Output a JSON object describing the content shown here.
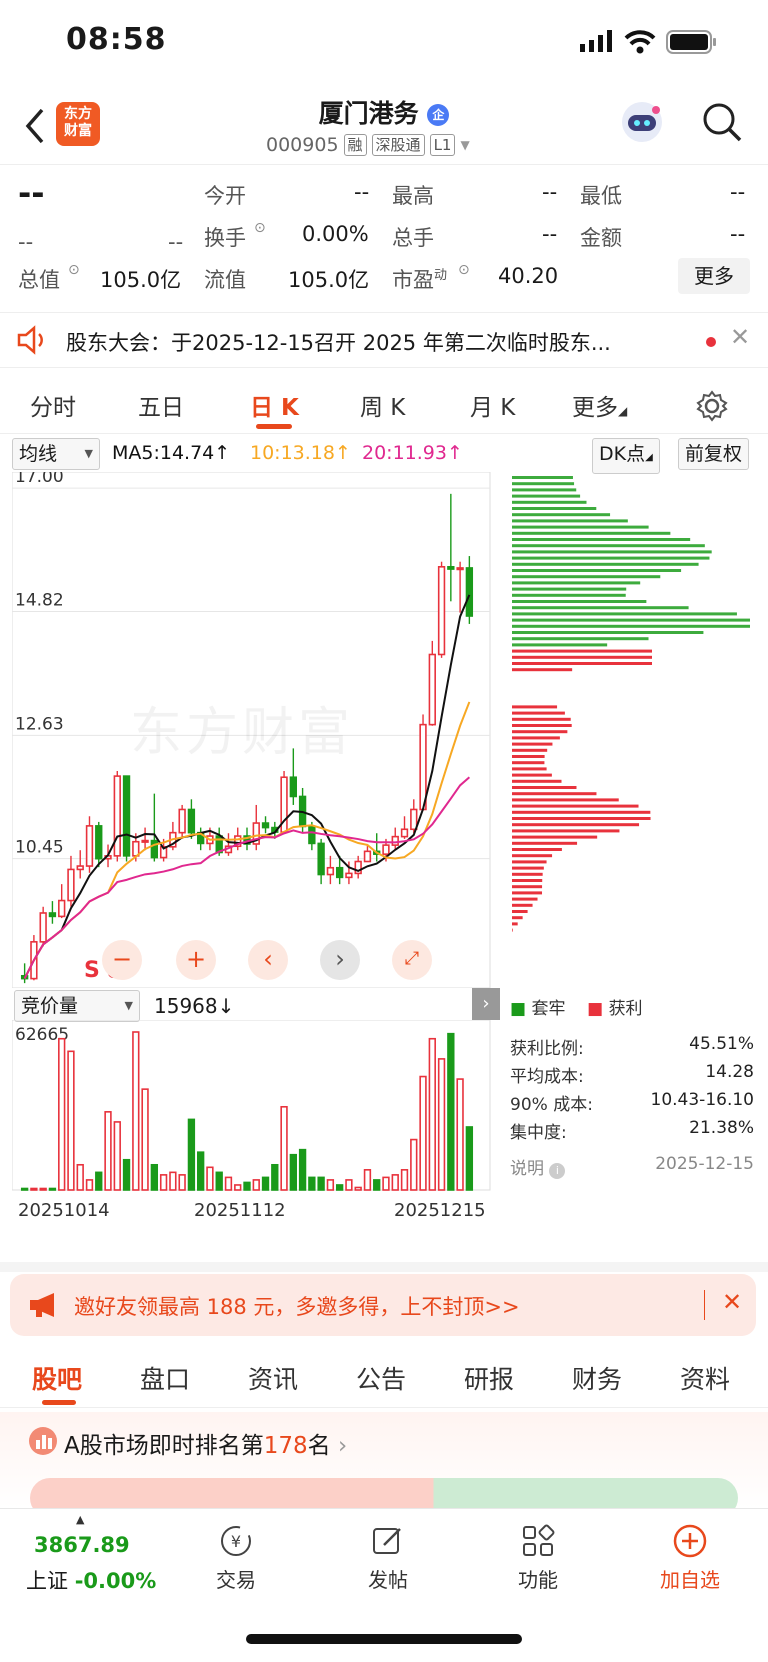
{
  "status_bar": {
    "time": "08:58"
  },
  "header": {
    "back_icon": "chevron-left-icon",
    "logo_text_1": "东方",
    "logo_text_2": "财富",
    "stock_name": "厦门港务",
    "badge": "企",
    "code": "000905",
    "tags": [
      "融",
      "深股通",
      "L1"
    ]
  },
  "quote": {
    "price": "--",
    "change": "--",
    "change_pct": "--",
    "rows": [
      [
        {
          "label": "今开",
          "value": "--"
        },
        {
          "label": "最高",
          "value": "--"
        },
        {
          "label": "最低",
          "value": "--"
        }
      ],
      [
        {
          "label": "换手",
          "value": "0.00%"
        },
        {
          "label": "总手",
          "value": "--"
        },
        {
          "label": "金额",
          "value": "--"
        }
      ],
      [
        {
          "label": "总值",
          "value": "105.0亿"
        },
        {
          "label": "流值",
          "value": "105.0亿"
        },
        {
          "label": "市盈",
          "sup": "动",
          "value": "40.20"
        }
      ]
    ],
    "more": "更多"
  },
  "notice": {
    "text": "股东大会：于2025-12-15召开 2025 年第二次临时股东..."
  },
  "chart_tabs": [
    "分时",
    "五日",
    "日 K",
    "周 K",
    "月 K",
    "更多"
  ],
  "ma_bar": {
    "selector": "均线",
    "ma5": "MA5:14.74↑",
    "ma10": "10:13.18↑",
    "ma20": "20:11.93↑",
    "dk": "DK点",
    "adjust": "前复权"
  },
  "colors": {
    "up": "#e8323c",
    "down": "#1a9a1a",
    "ma5": "#111111",
    "ma10": "#f7a823",
    "ma20": "#e0288f",
    "accent": "#e8481c"
  },
  "chart_data": [
    {
      "type": "candlestick",
      "yticks": [
        "17.00",
        "14.82",
        "12.63",
        "10.45"
      ],
      "ylim": [
        8.27,
        17.18
      ],
      "series": {
        "ma5_last": 14.74,
        "ma10_last": 13.18,
        "ma20_last": 11.93
      },
      "open": [
        8.38,
        8.33,
        8.98,
        9.49,
        9.43,
        9.71,
        10.26,
        10.32,
        11.03,
        10.45,
        10.5,
        11.91,
        10.5,
        10.75,
        10.77,
        10.47,
        10.66,
        10.91,
        11.32,
        10.91,
        10.72,
        10.85,
        10.56,
        10.67,
        10.85,
        10.71,
        11.08,
        11.0,
        10.92,
        11.89,
        11.55,
        11.02,
        10.72,
        10.17,
        10.29,
        10.12,
        10.19,
        10.4,
        10.58,
        10.53,
        10.69,
        10.84,
        10.97,
        11.32,
        12.82,
        14.06,
        15.61,
        15.57,
        15.59
      ],
      "close": [
        8.33,
        8.98,
        9.49,
        9.43,
        9.71,
        10.26,
        10.32,
        11.03,
        10.45,
        10.5,
        11.91,
        10.5,
        10.75,
        10.77,
        10.47,
        10.66,
        10.91,
        11.32,
        10.91,
        10.72,
        10.85,
        10.56,
        10.67,
        10.85,
        10.71,
        11.08,
        11.0,
        10.92,
        11.89,
        11.55,
        11.02,
        10.72,
        10.17,
        10.29,
        10.12,
        10.19,
        10.4,
        10.58,
        10.53,
        10.69,
        10.84,
        10.97,
        11.32,
        12.82,
        14.06,
        15.61,
        15.57,
        15.59,
        14.74
      ],
      "high": [
        8.6,
        9.1,
        9.6,
        9.7,
        10.0,
        10.5,
        10.6,
        11.2,
        11.1,
        10.7,
        12.0,
        11.9,
        10.9,
        11.0,
        11.6,
        10.8,
        11.1,
        11.4,
        11.5,
        11.0,
        11.0,
        11.0,
        10.9,
        11.0,
        11.0,
        11.4,
        11.2,
        11.1,
        12.0,
        12.4,
        11.7,
        11.1,
        10.8,
        10.5,
        10.5,
        10.4,
        10.5,
        10.7,
        10.9,
        10.8,
        11.0,
        11.2,
        11.5,
        13.0,
        14.3,
        15.7,
        16.9,
        15.7,
        15.8
      ],
      "low": [
        8.25,
        8.3,
        8.9,
        9.3,
        9.4,
        9.6,
        10.1,
        10.2,
        10.3,
        10.3,
        10.4,
        10.4,
        10.4,
        10.6,
        10.4,
        10.4,
        10.6,
        10.8,
        10.8,
        10.6,
        10.6,
        10.5,
        10.5,
        10.6,
        10.6,
        10.6,
        10.9,
        10.8,
        10.9,
        11.4,
        10.9,
        10.6,
        10.0,
        10.0,
        10.0,
        10.0,
        10.1,
        10.4,
        10.4,
        10.4,
        10.6,
        10.8,
        10.9,
        11.3,
        12.8,
        14.0,
        15.0,
        14.8,
        14.6
      ]
    },
    {
      "type": "bar",
      "title": "竞价量",
      "last": "15968↓",
      "ytick": "62665",
      "values": [
        600,
        600,
        600,
        600,
        60000,
        55000,
        10000,
        4000,
        7000,
        31000,
        27000,
        12000,
        62665,
        40000,
        10000,
        6000,
        7000,
        6000,
        28000,
        15000,
        9000,
        7000,
        5000,
        2000,
        3000,
        4000,
        5000,
        10000,
        33000,
        14000,
        16000,
        5000,
        5000,
        4000,
        2000,
        4000,
        1000,
        8000,
        4000,
        5000,
        6000,
        8000,
        20000,
        45000,
        60000,
        52000,
        62000,
        44000,
        25000
      ],
      "dates": [
        "20251014",
        "20251112",
        "20251215"
      ]
    },
    {
      "type": "bar",
      "title": "筹码分布",
      "legend": [
        "套牢",
        "获利"
      ]
    }
  ],
  "chart_controls": {
    "s_label": "S"
  },
  "chip_stats": [
    {
      "label": "获利比例:",
      "value": "45.51%"
    },
    {
      "label": "平均成本:",
      "value": "14.28"
    },
    {
      "label": "90% 成本:",
      "value": "10.43-16.10"
    },
    {
      "label": "集中度:",
      "value": "21.38%"
    },
    {
      "label": "说明",
      "value": "2025-12-15"
    }
  ],
  "promo": {
    "text": "邀好友领最高 188 元，多邀多得，上不封顶>>"
  },
  "bottom_tabs": [
    "股吧",
    "盘口",
    "资讯",
    "公告",
    "研报",
    "财务",
    "资料"
  ],
  "rank": {
    "prefix": "A股市场即时排名第",
    "num": "178",
    "suffix": "名"
  },
  "dock": {
    "index_value": "3867.89",
    "index_label": "上证",
    "index_change": "-0.00%",
    "items": [
      "交易",
      "发帖",
      "功能",
      "加自选"
    ]
  },
  "watermark": "东方财富"
}
